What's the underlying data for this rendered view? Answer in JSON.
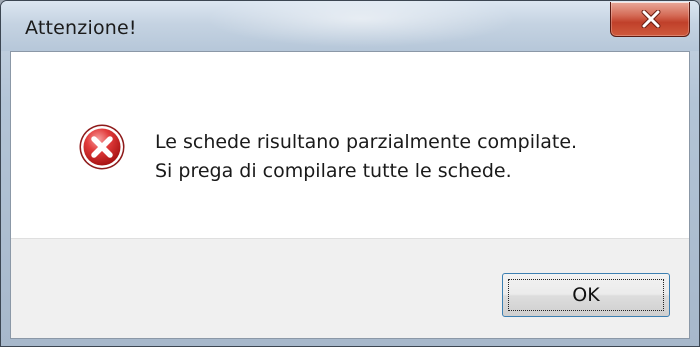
{
  "window": {
    "title": "Attenzione!",
    "close_icon": "close-x-icon"
  },
  "dialog": {
    "icon": "error-icon",
    "message_line1": "Le schede risultano parzialmente compilate.",
    "message_line2": "Si prega di compilare tutte le schede.",
    "ok_label": "OK"
  },
  "colors": {
    "error_red": "#d12b2b",
    "close_button_red": "#c74a32",
    "ok_border_blue": "#3c7fb1"
  }
}
